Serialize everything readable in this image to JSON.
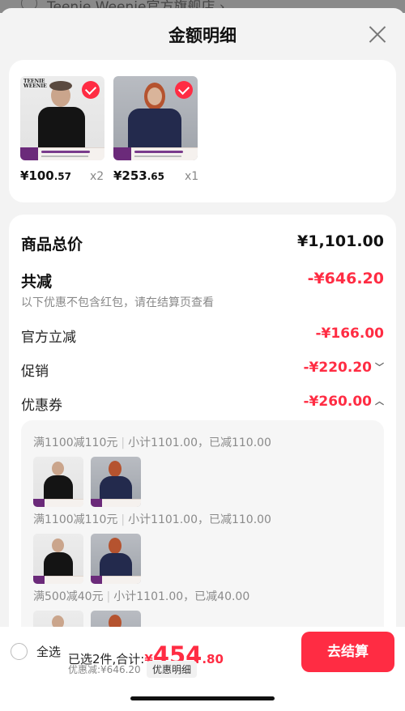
{
  "background": {
    "store_name": "Teenie Weenie官方旗舰店 ›"
  },
  "header": {
    "title": "金额明细"
  },
  "products": [
    {
      "price_int": "¥100",
      "price_dec": ".57",
      "qty": "x2",
      "brand": "TEENIE WEENIE"
    },
    {
      "price_int": "¥253",
      "price_dec": ".65",
      "qty": "x1",
      "brand": ""
    }
  ],
  "detail": {
    "subtotal_label": "商品总价",
    "subtotal_value": "¥1,101.00",
    "total_discount_label": "共减",
    "total_discount_value": "-¥646.20",
    "note": "以下优惠不包含红包，请在结算页查看",
    "official_label": "官方立减",
    "official_value": "-¥166.00",
    "promo_label": "促销",
    "promo_value": "-¥220.20",
    "coupon_label": "优惠券",
    "coupon_value": "-¥260.00"
  },
  "coupons": [
    {
      "rule": "满1100减110元",
      "detail": "小计1101.00，已减110.00"
    },
    {
      "rule": "满1100减110元",
      "detail": "小计1101.00，已减110.00"
    },
    {
      "rule": "满500减40元",
      "detail": "小计1101.00，已减40.00"
    }
  ],
  "bottom": {
    "select_all": "全选",
    "summary_prefix": "已选2件,合计:",
    "total_yen": "¥",
    "total_int": "454",
    "total_dec": ".80",
    "discount_note": "优惠减:¥646.20",
    "detail_link": "优惠明细",
    "checkout": "去结算"
  },
  "colors": {
    "accent": "#ff2c43",
    "background": "#f3f3f3"
  }
}
